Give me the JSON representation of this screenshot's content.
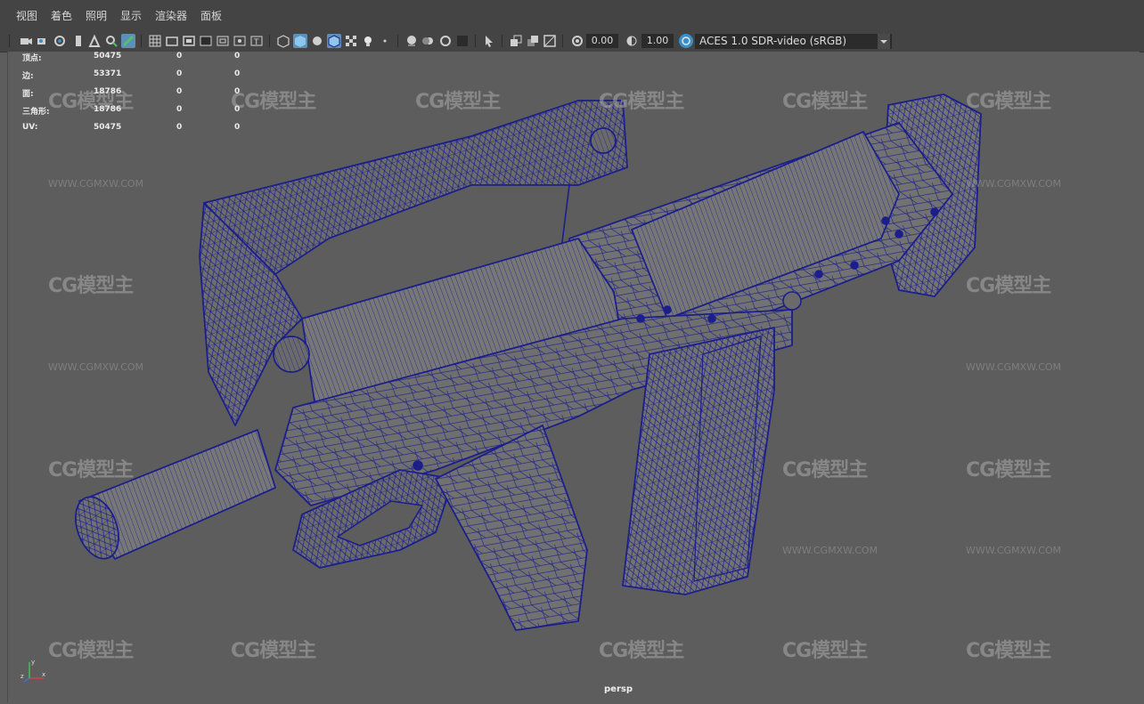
{
  "menu": [
    "视图",
    "着色",
    "照明",
    "显示",
    "渲染器",
    "面板"
  ],
  "toolbar": {
    "exposure_value": "0.00",
    "gamma_value": "1.00",
    "color_space": "ACES 1.0 SDR-video (sRGB)",
    "accent_color": "#5e8fb4"
  },
  "hud_stats": [
    {
      "label": "顶点:",
      "value": "50475",
      "sel": "0",
      "comp": "0"
    },
    {
      "label": "边:",
      "value": "53371",
      "sel": "0",
      "comp": "0"
    },
    {
      "label": "面:",
      "value": "18786",
      "sel": "0",
      "comp": "0"
    },
    {
      "label": "三角形:",
      "value": "18786",
      "sel": "0",
      "comp": "0"
    },
    {
      "label": "UV:",
      "value": "50475",
      "sel": "0",
      "comp": "0"
    }
  ],
  "viewport": {
    "camera": "persp",
    "wireframe_color": "#1c1f8a",
    "background": "#5d5d5d"
  },
  "watermark": {
    "logo_text": "CG模型主",
    "url": "WWW.CGMXW.COM"
  },
  "axis": {
    "x": "x",
    "y": "y",
    "z": "z"
  }
}
